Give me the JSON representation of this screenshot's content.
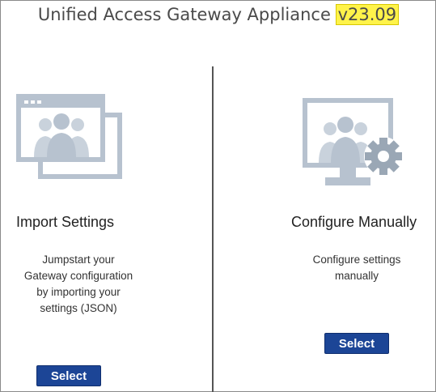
{
  "header": {
    "title_prefix": "Unified Access Gateway Appliance ",
    "version": "v23.09"
  },
  "colors": {
    "highlight": "#fff34a",
    "button": "#1c4596",
    "icon": "#b7c2cf"
  },
  "options": [
    {
      "title": "Import Settings",
      "description_lines": [
        "Jumpstart your",
        "Gateway configuration",
        "by importing your",
        "settings (JSON)"
      ],
      "button_label": "Select",
      "icon": "import-windows-users-icon"
    },
    {
      "title": "Configure Manually",
      "description_lines": [
        "Configure settings",
        "manually"
      ],
      "button_label": "Select",
      "icon": "monitor-users-gear-icon"
    }
  ]
}
